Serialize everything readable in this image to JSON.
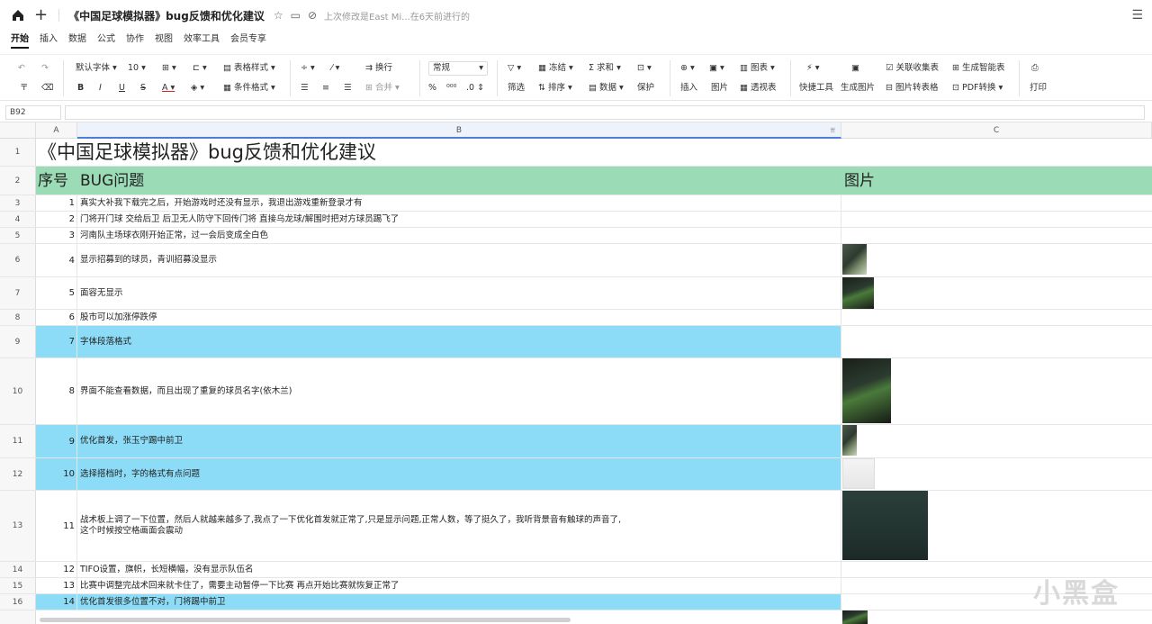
{
  "titlebar": {
    "doc_title": "《中国足球模拟器》bug反馈和优化建议",
    "status": "上次修改是East Mi...在6天前进行的"
  },
  "menu_tabs": [
    "开始",
    "插入",
    "数据",
    "公式",
    "协作",
    "视图",
    "效率工具",
    "会员专享"
  ],
  "ribbon": {
    "font_name": "默认字体",
    "font_size": "10",
    "table_style": "表格样式",
    "cond_format": "条件格式",
    "wrap": "换行",
    "merge": "合并",
    "number_format": "常规",
    "freeze": "冻结",
    "sum": "求和",
    "filter": "筛选",
    "sort": "排序",
    "data": "数据",
    "protect": "保护",
    "insert": "插入",
    "picture": "图片",
    "chart": "图表",
    "pivot": "透视表",
    "quick_tools": "快捷工具",
    "gen_image": "生成图片",
    "collect": "关联收集表",
    "smart_table": "生成智能表",
    "img_to_table": "图片转表格",
    "pdf": "PDF转换",
    "print": "打印"
  },
  "formula_bar": {
    "cell_ref": "B92"
  },
  "columns": [
    "A",
    "B",
    "C"
  ],
  "sheet": {
    "title": "《中国足球模拟器》bug反馈和优化建议",
    "header": {
      "a": "序号",
      "b": "BUG问题",
      "c": "图片"
    },
    "rows": [
      {
        "row": "3",
        "num": "1",
        "text": "真实大补我下载完之后，开始游戏时还没有显示，我退出游戏重新登录才有"
      },
      {
        "row": "4",
        "num": "2",
        "text": "门将开门球 交给后卫 后卫无人防守下回传门将 直接乌龙球/解围时把对方球员踢飞了"
      },
      {
        "row": "5",
        "num": "3",
        "text": "河南队主场球衣刚开始正常，过一会后变成全白色"
      },
      {
        "row": "6",
        "num": "4",
        "text": "显示招募到的球员，青训招募没显示"
      },
      {
        "row": "7",
        "num": "5",
        "text": "面容无显示"
      },
      {
        "row": "8",
        "num": "6",
        "text": "股市可以加涨停跌停"
      },
      {
        "row": "9",
        "num": "7",
        "text": "字体段落格式"
      },
      {
        "row": "10",
        "num": "8",
        "text": "界面不能查看数据，而且出现了重复的球员名字(依木兰)"
      },
      {
        "row": "11",
        "num": "9",
        "text": "优化首发，张玉宁踢中前卫"
      },
      {
        "row": "12",
        "num": "10",
        "text": "选择搭档时，字的格式有点问题"
      },
      {
        "row": "13",
        "num": "11",
        "text": "战术板上调了一下位置，然后人就越来越多了,我点了一下优化首发就正常了,只是显示问题,正常人数，等了挺久了，我听背景音有触球的声音了,",
        "text2": "这个时候按空格画面会震动"
      },
      {
        "row": "14",
        "num": "12",
        "text": "TIFO设置，旗帜，长短横幅，没有显示队伍名"
      },
      {
        "row": "15",
        "num": "13",
        "text": "比赛中调整完战术回来就卡住了，需要主动暂停一下比赛 再点开始比赛就恢复正常了"
      },
      {
        "row": "16",
        "num": "14",
        "text": "优化首发很多位置不对，门将踢中前卫"
      }
    ]
  },
  "watermark": "小黑盒"
}
